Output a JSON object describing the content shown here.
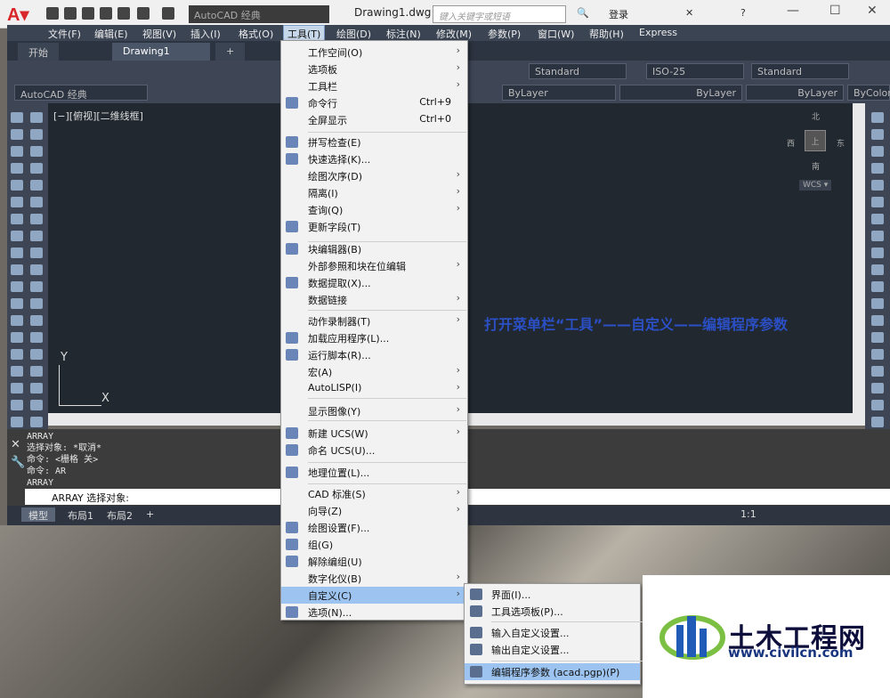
{
  "titlebar": {
    "workspace": "AutoCAD 经典",
    "doc_title": "Drawing1.dwg",
    "search_placeholder": "键入关键字或短语",
    "login": "登录"
  },
  "menubar": [
    "文件(F)",
    "编辑(E)",
    "视图(V)",
    "插入(I)",
    "格式(O)",
    "工具(T)",
    "绘图(D)",
    "标注(N)",
    "修改(M)",
    "参数(P)",
    "窗口(W)",
    "帮助(H)",
    "Express"
  ],
  "tabs": [
    "开始",
    "Drawing1",
    "+"
  ],
  "toolbar": {
    "textstyle": "Standard",
    "dimstyle": "ISO-25",
    "tablestyle": "Standard",
    "workspace2": "AutoCAD 经典",
    "color": "ByLayer",
    "linetype": "ByLayer",
    "lineweight": "ByLayer",
    "plotstyle": "ByColor"
  },
  "viewport": {
    "label": "[−][俯视][二维线框]",
    "compass_n": "北",
    "compass_s": "南",
    "compass_e": "东",
    "compass_w": "西",
    "compass_c": "上",
    "wcs": "WCS ▾",
    "axis_x": "X",
    "axis_y": "Y"
  },
  "annotation": "打开菜单栏“工具”——自定义——编辑程序参数",
  "command": {
    "history": [
      "ARRAY",
      "选择对象: *取消*",
      "命令:  <栅格 关>",
      "命令: AR",
      "ARRAY"
    ],
    "prompt": "ARRAY 选择对象:"
  },
  "statusbar": {
    "tabs": [
      "模型",
      "布局1",
      "布局2",
      "+"
    ],
    "scale": "1:1"
  },
  "tools_menu": [
    {
      "label": "工作空间(O)",
      "arrow": true
    },
    {
      "label": "选项板",
      "arrow": true
    },
    {
      "label": "工具栏",
      "arrow": true
    },
    {
      "label": "命令行",
      "shortcut": "Ctrl+9"
    },
    {
      "label": "全屏显示",
      "shortcut": "Ctrl+0"
    },
    {
      "label": "拼写检查(E)"
    },
    {
      "label": "快速选择(K)..."
    },
    {
      "label": "绘图次序(D)",
      "arrow": true
    },
    {
      "label": "隔离(I)",
      "arrow": true
    },
    {
      "label": "查询(Q)",
      "arrow": true
    },
    {
      "label": "更新字段(T)"
    },
    {
      "label": "块编辑器(B)"
    },
    {
      "label": "外部参照和块在位编辑",
      "arrow": true
    },
    {
      "label": "数据提取(X)..."
    },
    {
      "label": "数据链接",
      "arrow": true
    },
    {
      "label": "动作录制器(T)",
      "arrow": true
    },
    {
      "label": "加载应用程序(L)..."
    },
    {
      "label": "运行脚本(R)..."
    },
    {
      "label": "宏(A)",
      "arrow": true
    },
    {
      "label": "AutoLISP(I)",
      "arrow": true
    },
    {
      "label": "显示图像(Y)",
      "arrow": true
    },
    {
      "label": "新建 UCS(W)",
      "arrow": true
    },
    {
      "label": "命名 UCS(U)..."
    },
    {
      "label": "地理位置(L)..."
    },
    {
      "label": "CAD 标准(S)",
      "arrow": true
    },
    {
      "label": "向导(Z)",
      "arrow": true
    },
    {
      "label": "绘图设置(F)..."
    },
    {
      "label": "组(G)"
    },
    {
      "label": "解除编组(U)"
    },
    {
      "label": "数字化仪(B)",
      "arrow": true
    },
    {
      "label": "自定义(C)",
      "arrow": true
    },
    {
      "label": "选项(N)..."
    }
  ],
  "customize_submenu": [
    "界面(I)...",
    "工具选项板(P)...",
    "输入自定义设置...",
    "输出自定义设置...",
    "编辑程序参数 (acad.pgp)(P)"
  ],
  "watermark": {
    "name": "土木工程网",
    "url": "www.civilcn.com"
  }
}
